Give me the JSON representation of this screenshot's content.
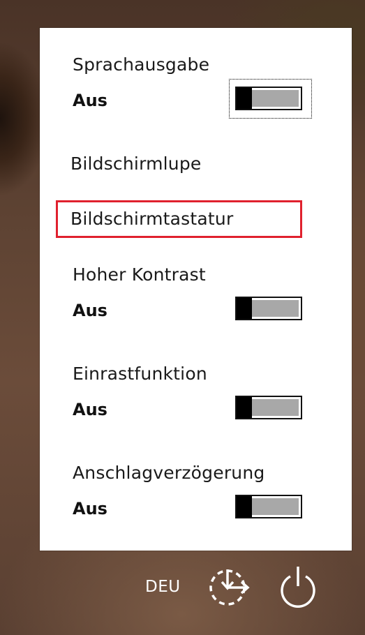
{
  "panel": {
    "items": [
      {
        "title": "Sprachausgabe",
        "state": "Aus",
        "toggle": "off"
      },
      {
        "title": "Bildschirmlupe"
      },
      {
        "title": "Bildschirmtastatur"
      },
      {
        "title": "Hoher Kontrast",
        "state": "Aus",
        "toggle": "off"
      },
      {
        "title": "Einrastfunktion",
        "state": "Aus",
        "toggle": "off"
      },
      {
        "title": "Anschlagverzögerung",
        "state": "Aus",
        "toggle": "off"
      }
    ],
    "highlight_color": "#e0212e"
  },
  "bottom_bar": {
    "language": "DEU",
    "ease_of_access_icon": "ease-of-access-icon",
    "power_icon": "power-icon"
  }
}
